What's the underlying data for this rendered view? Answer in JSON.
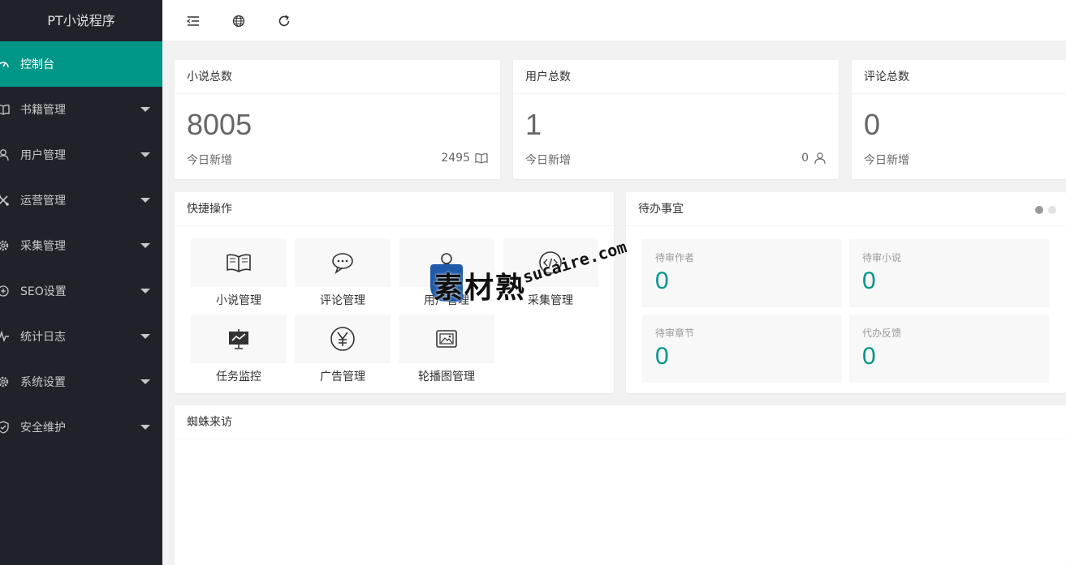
{
  "app": {
    "title": "PT小说程序"
  },
  "sidebar": {
    "items": [
      {
        "label": "控制台",
        "icon": "dashboard-icon",
        "active": true,
        "has_submenu": false
      },
      {
        "label": "书籍管理",
        "icon": "book-icon",
        "active": false,
        "has_submenu": true
      },
      {
        "label": "用户管理",
        "icon": "user-icon",
        "active": false,
        "has_submenu": true
      },
      {
        "label": "运营管理",
        "icon": "tools-icon",
        "active": false,
        "has_submenu": true
      },
      {
        "label": "采集管理",
        "icon": "gear-icon",
        "active": false,
        "has_submenu": true
      },
      {
        "label": "SEO设置",
        "icon": "seo-icon",
        "active": false,
        "has_submenu": true
      },
      {
        "label": "统计日志",
        "icon": "pulse-icon",
        "active": false,
        "has_submenu": true
      },
      {
        "label": "系统设置",
        "icon": "gear-icon",
        "active": false,
        "has_submenu": true
      },
      {
        "label": "安全维护",
        "icon": "shield-icon",
        "active": false,
        "has_submenu": true
      }
    ]
  },
  "header": {
    "buttons": [
      {
        "icon": "menu-collapse-icon"
      },
      {
        "icon": "globe-icon"
      },
      {
        "icon": "refresh-icon"
      }
    ]
  },
  "stats": [
    {
      "title": "小说总数",
      "value": "8005",
      "today_label": "今日新增",
      "today_value": "2495",
      "icon": "book-icon"
    },
    {
      "title": "用户总数",
      "value": "1",
      "today_label": "今日新增",
      "today_value": "0",
      "icon": "user-icon"
    },
    {
      "title": "评论总数",
      "value": "0",
      "today_label": "今日新增",
      "today_value": "",
      "icon": ""
    }
  ],
  "quick_actions": {
    "title": "快捷操作",
    "items": [
      {
        "label": "小说管理",
        "icon": "book-icon"
      },
      {
        "label": "评论管理",
        "icon": "comment-icon"
      },
      {
        "label": "用户管理",
        "icon": "user-icon"
      },
      {
        "label": "采集管理",
        "icon": "code-icon"
      },
      {
        "label": "任务监控",
        "icon": "monitor-icon"
      },
      {
        "label": "广告管理",
        "icon": "yen-icon"
      },
      {
        "label": "轮播图管理",
        "icon": "image-icon"
      }
    ]
  },
  "todo": {
    "title": "待办事宜",
    "items": [
      {
        "label": "待审作者",
        "value": "0"
      },
      {
        "label": "待审小说",
        "value": "0"
      },
      {
        "label": "待审章节",
        "value": "0"
      },
      {
        "label": "代办反馈",
        "value": "0"
      }
    ]
  },
  "spider": {
    "title": "蜘蛛来访"
  },
  "watermark": {
    "cn": "素材熟",
    "en": "sucaire.com"
  },
  "colors": {
    "accent": "#009688",
    "sidebar_bg": "#20222a",
    "page_bg": "#f2f2f2"
  }
}
